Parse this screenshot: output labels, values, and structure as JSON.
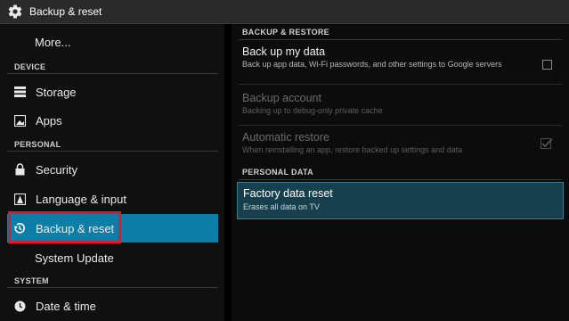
{
  "app": {
    "title": "Backup & reset"
  },
  "sidebar": {
    "more": "More...",
    "sections": {
      "device": "DEVICE",
      "personal": "PERSONAL",
      "system": "SYSTEM"
    },
    "items": {
      "storage": "Storage",
      "apps": "Apps",
      "security": "Security",
      "language": "Language & input",
      "backup": "Backup & reset",
      "system_update": "System Update",
      "date_time": "Date & time"
    },
    "selected": "Backup & reset"
  },
  "main": {
    "backup_section": "BACKUP & RESTORE",
    "backup_my_data": {
      "title": "Back up my data",
      "subtitle": "Back up app data, Wi-Fi passwords, and other settings to Google servers",
      "checked": false
    },
    "backup_account": {
      "title": "Backup account",
      "subtitle": "Backing up to debug-only private cache"
    },
    "auto_restore": {
      "title": "Automatic restore",
      "subtitle": "When reinstalling an app, restore backed up settings and data",
      "checked": true
    },
    "personal_section": "PERSONAL DATA",
    "factory_reset": {
      "title": "Factory data reset",
      "subtitle": "Erases all data on TV"
    }
  },
  "colors": {
    "selected_bg": "#0d7ea7",
    "highlight_border": "#e0182b",
    "factory_bg": "#16404d"
  }
}
